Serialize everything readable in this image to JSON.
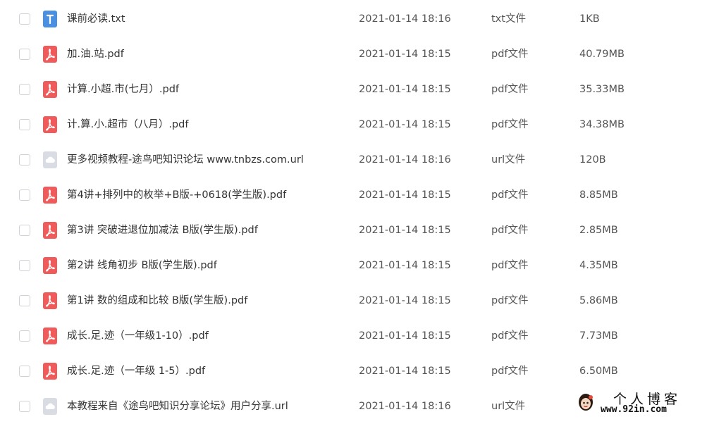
{
  "colors": {
    "txt_icon": "#4a90e2",
    "pdf_icon": "#f05a5a",
    "url_icon": "#d9dde3"
  },
  "files": [
    {
      "name": "课前必读.txt",
      "date": "2021-01-14 18:16",
      "type": "txt文件",
      "size": "1KB",
      "icon": "txt-icon"
    },
    {
      "name": "加.油.站.pdf",
      "date": "2021-01-14 18:15",
      "type": "pdf文件",
      "size": "40.79MB",
      "icon": "pdf-icon"
    },
    {
      "name": "计算.小超.市(七月）.pdf",
      "date": "2021-01-14 18:15",
      "type": "pdf文件",
      "size": "35.33MB",
      "icon": "pdf-icon"
    },
    {
      "name": "计.算.小.超市（八月）.pdf",
      "date": "2021-01-14 18:15",
      "type": "pdf文件",
      "size": "34.38MB",
      "icon": "pdf-icon"
    },
    {
      "name": "更多视频教程-途鸟吧知识论坛 www.tnbzs.com.url",
      "date": "2021-01-14 18:16",
      "type": "url文件",
      "size": "120B",
      "icon": "url-icon"
    },
    {
      "name": "第4讲+排列中的枚举+B版-+0618(学生版).pdf",
      "date": "2021-01-14 18:15",
      "type": "pdf文件",
      "size": "8.85MB",
      "icon": "pdf-icon"
    },
    {
      "name": "第3讲 突破进退位加减法  B版(学生版).pdf",
      "date": "2021-01-14 18:15",
      "type": "pdf文件",
      "size": "2.85MB",
      "icon": "pdf-icon"
    },
    {
      "name": "第2讲 线角初步 B版(学生版).pdf",
      "date": "2021-01-14 18:15",
      "type": "pdf文件",
      "size": "4.35MB",
      "icon": "pdf-icon"
    },
    {
      "name": "第1讲 数的组成和比较 B版(学生版).pdf",
      "date": "2021-01-14 18:15",
      "type": "pdf文件",
      "size": "5.86MB",
      "icon": "pdf-icon"
    },
    {
      "name": "成长.足.迹（一年级1-10）.pdf",
      "date": "2021-01-14 18:15",
      "type": "pdf文件",
      "size": "7.73MB",
      "icon": "pdf-icon"
    },
    {
      "name": "成长.足.迹（一年级 1-5）.pdf",
      "date": "2021-01-14 18:15",
      "type": "pdf文件",
      "size": "6.50MB",
      "icon": "pdf-icon"
    },
    {
      "name": "本教程来自《途鸟吧知识分享论坛》用户分享.url",
      "date": "2021-01-14 18:16",
      "type": "url文件",
      "size": "",
      "icon": "url-icon"
    }
  ],
  "watermark": {
    "title": "个人博客",
    "url": "www.92in.com"
  }
}
